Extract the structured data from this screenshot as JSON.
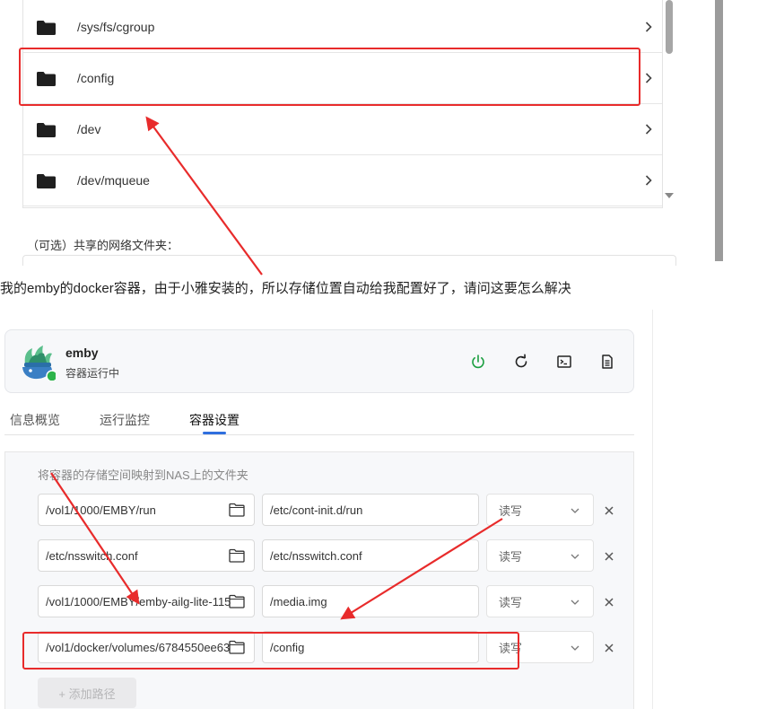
{
  "folder_picker": {
    "items": [
      {
        "path": "/sys/fs/cgroup"
      },
      {
        "path": "/config"
      },
      {
        "path": "/dev"
      },
      {
        "path": "/dev/mqueue"
      }
    ],
    "icons": {
      "folder": "folder-icon",
      "chevron": "chevron-right-icon"
    },
    "shared_label": "（可选）共享的网络文件夹："
  },
  "question": "我的emby的docker容器，由于小雅安装的，所以存储位置自动给我配置好了，请问这要怎么解决",
  "container": {
    "name": "emby",
    "status": "容器运行中",
    "status_color": "#2cb34a",
    "power_color": "#1a9e3f",
    "actions": [
      "power-icon",
      "restart-icon",
      "terminal-icon",
      "log-icon"
    ]
  },
  "tabs": [
    {
      "label": "信息概览",
      "active": false
    },
    {
      "label": "运行监控",
      "active": false
    },
    {
      "label": "容器设置",
      "active": true
    }
  ],
  "accent": "#2f6fde",
  "storage": {
    "title": "将容器的存储空间映射到NAS上的文件夹",
    "rows": [
      {
        "host": "/vol1/1000/EMBY/run",
        "container": "/etc/cont-init.d/run",
        "mode": "读写"
      },
      {
        "host": "/etc/nsswitch.conf",
        "container": "/etc/nsswitch.conf",
        "mode": "读写"
      },
      {
        "host": "/vol1/1000/EMBY/emby-ailg-lite-115",
        "container": "/media.img",
        "mode": "读写"
      },
      {
        "host": "/vol1/docker/volumes/6784550ee63",
        "container": "/config",
        "mode": "读写"
      }
    ],
    "add_label": "+ 添加路径"
  },
  "annotation_color": "#e82b2b"
}
